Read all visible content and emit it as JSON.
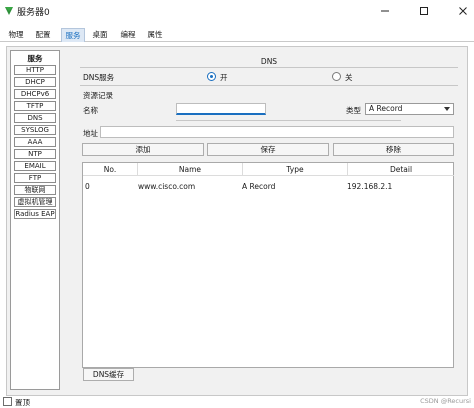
{
  "window": {
    "title": "服务器0",
    "minimize_glyph": "—",
    "maximize_glyph": "☐",
    "close_glyph": "✕"
  },
  "tabs": [
    {
      "label": "物理",
      "active": false
    },
    {
      "label": "配置",
      "active": false
    },
    {
      "label": "服务",
      "active": true
    },
    {
      "label": "桌面",
      "active": false
    },
    {
      "label": "编程",
      "active": false
    },
    {
      "label": "属性",
      "active": false
    }
  ],
  "services": {
    "header": "服务",
    "items": [
      "HTTP",
      "DHCP",
      "DHCPv6",
      "TFTP",
      "DNS",
      "SYSLOG",
      "AAA",
      "NTP",
      "EMAIL",
      "FTP",
      "物联网",
      "虚拟机管理",
      "Radius EAP"
    ]
  },
  "dns": {
    "title": "DNS",
    "service_label": "DNS服务",
    "on_label": "开",
    "off_label": "关",
    "service_state": "on",
    "records_label": "资源记录",
    "name_label": "名称",
    "name_value": "",
    "type_label": "类型",
    "type_value": "A Record",
    "address_label": "地址",
    "address_value": "",
    "add_button": "添加",
    "save_button": "保存",
    "remove_button": "移除",
    "cache_button": "DNS缓存"
  },
  "table": {
    "headers": [
      "No.",
      "Name",
      "Type",
      "Detail"
    ],
    "rows": [
      [
        "0",
        "www.cisco.com",
        "A Record",
        "192.168.2.1"
      ]
    ]
  },
  "bottom": {
    "checkbox_label": "置顶",
    "watermark": "CSDN @Recursi"
  },
  "colors": {
    "accent": "#1a6fc0",
    "app_icon_green": "#2f8f3a"
  },
  "icons": {
    "app": "server-app-icon",
    "minimize": "minimize-icon",
    "maximize": "maximize-icon",
    "close": "close-icon",
    "dropdown": "chevron-down-icon"
  }
}
